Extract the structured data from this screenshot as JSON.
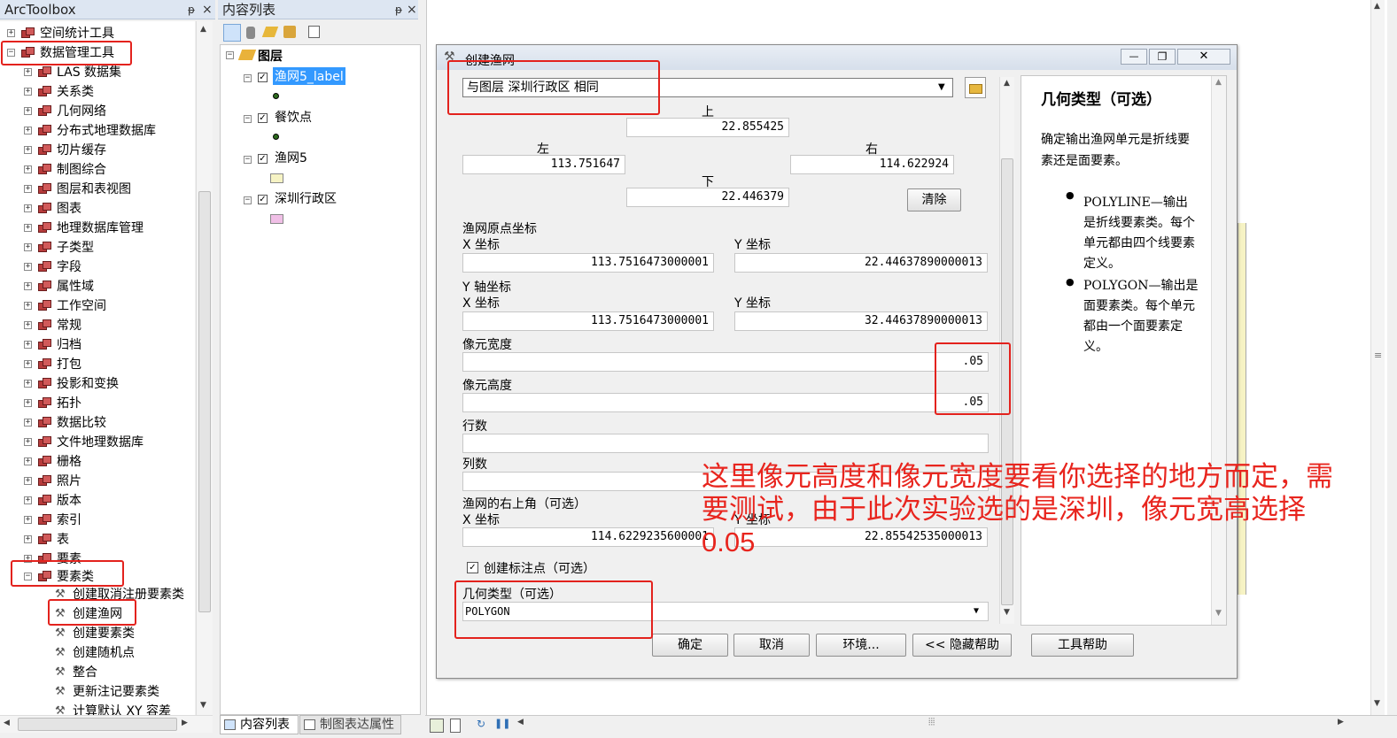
{
  "arctoolbox": {
    "title": "ArcToolbox",
    "pin": "ᵽ",
    "close": "×",
    "items": [
      {
        "label": "空间统计工具",
        "sign": "+"
      },
      {
        "label": "数据管理工具",
        "sign": "−"
      },
      {
        "label": "LAS 数据集",
        "sign": "+"
      },
      {
        "label": "关系类",
        "sign": "+"
      },
      {
        "label": "几何网络",
        "sign": "+"
      },
      {
        "label": "分布式地理数据库",
        "sign": "+"
      },
      {
        "label": "切片缓存",
        "sign": "+"
      },
      {
        "label": "制图综合",
        "sign": "+"
      },
      {
        "label": "图层和表视图",
        "sign": "+"
      },
      {
        "label": "图表",
        "sign": "+"
      },
      {
        "label": "地理数据库管理",
        "sign": "+"
      },
      {
        "label": "子类型",
        "sign": "+"
      },
      {
        "label": "字段",
        "sign": "+"
      },
      {
        "label": "属性域",
        "sign": "+"
      },
      {
        "label": "工作空间",
        "sign": "+"
      },
      {
        "label": "常规",
        "sign": "+"
      },
      {
        "label": "归档",
        "sign": "+"
      },
      {
        "label": "打包",
        "sign": "+"
      },
      {
        "label": "投影和变换",
        "sign": "+"
      },
      {
        "label": "拓扑",
        "sign": "+"
      },
      {
        "label": "数据比较",
        "sign": "+"
      },
      {
        "label": "文件地理数据库",
        "sign": "+"
      },
      {
        "label": "栅格",
        "sign": "+"
      },
      {
        "label": "照片",
        "sign": "+"
      },
      {
        "label": "版本",
        "sign": "+"
      },
      {
        "label": "索引",
        "sign": "+"
      },
      {
        "label": "表",
        "sign": "+"
      },
      {
        "label": "要素",
        "sign": "+"
      },
      {
        "label": "要素类",
        "sign": "−"
      }
    ],
    "tools": [
      "创建取消注册要素类",
      "创建渔网",
      "创建要素类",
      "创建随机点",
      "整合",
      "更新注记要素类",
      "计算默认 XY 容差"
    ]
  },
  "toc": {
    "title": "内容列表",
    "pin": "ᵽ",
    "close": "×",
    "root": "图层",
    "layers": [
      {
        "name": "渔网5_label",
        "checked": "✓"
      },
      {
        "name": "餐饮点",
        "checked": "✓"
      },
      {
        "name": "渔网5",
        "checked": "✓"
      },
      {
        "name": "深圳行政区",
        "checked": "✓"
      }
    ],
    "tab_toc": "内容列表",
    "tab_carto": "制图表达属性"
  },
  "dialog": {
    "title": "创建渔网",
    "min": "—",
    "max": "❐",
    "close": "✕",
    "extent_select": "与图层 深圳行政区 相同",
    "top_label": "上",
    "top": "22.855425",
    "left_label": "左",
    "left": "113.751647",
    "right_label": "右",
    "right": "114.622924",
    "bottom_label": "下",
    "bottom": "22.446379",
    "clear": "清除",
    "origin_label": "渔网原点坐标",
    "x_label": "X 坐标",
    "y_label": "Y 坐标",
    "origin_x": "113.7516473000001",
    "origin_y": "22.44637890000013",
    "yaxis_label": "Y 轴坐标",
    "yaxis_x": "113.7516473000001",
    "yaxis_y": "32.44637890000013",
    "cell_width_label": "像元宽度",
    "cell_width": ".05",
    "cell_height_label": "像元高度",
    "cell_height": ".05",
    "rows_label": "行数",
    "rows": "",
    "cols_label": "列数",
    "cols": "",
    "corner_label": "渔网的右上角（可选）",
    "corner_x": "114.6229235600001",
    "corner_y": "22.85542535000013",
    "create_label_text": "创建标注点（可选）",
    "create_label_checked": "✓",
    "geom_label": "几何类型（可选）",
    "geom_value": "POLYGON",
    "ok": "确定",
    "cancel": "取消",
    "env": "环境...",
    "hide_help": "<< 隐藏帮助",
    "tool_help": "工具帮助"
  },
  "help": {
    "title": "几何类型（可选）",
    "desc": "确定输出渔网单元是折线要素还是面要素。",
    "b1_key": "POLYLINE",
    "b1_text": "—输出是折线要素类。每个单元都由四个线要素定义。",
    "b2_key": "POLYGON",
    "b2_text": "—输出是面要素类。每个单元都由一个面要素定义。"
  },
  "annotation": "这里像元高度和像元宽度要看你选择的地方而定，需要测试，由于此次实验选的是深圳，像元宽高选择0.05",
  "colors": {
    "highlight": "#e3221d",
    "annotation": "#e8251e",
    "selection": "#3399ff"
  }
}
